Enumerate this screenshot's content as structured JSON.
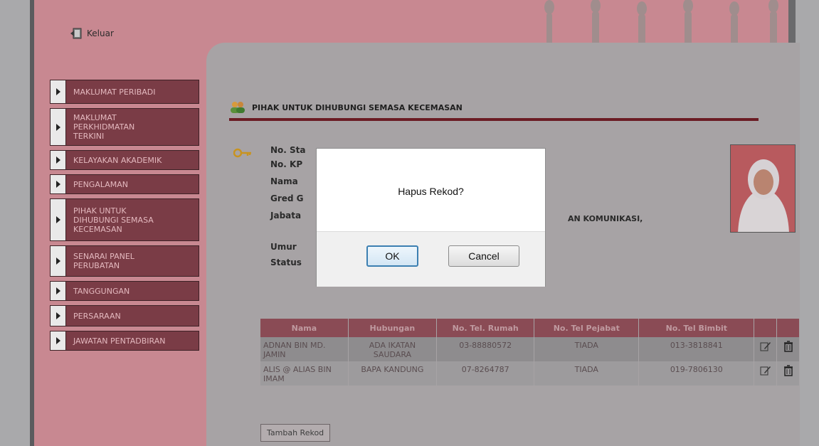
{
  "header": {
    "logout_label": "Keluar"
  },
  "sidebar": {
    "items": [
      {
        "label": "MAKLUMAT PERIBADI"
      },
      {
        "label": "MAKLUMAT PERKHIDMATAN TERKINI"
      },
      {
        "label": "KELAYAKAN AKADEMIK"
      },
      {
        "label": "PENGALAMAN"
      },
      {
        "label": "PIHAK UNTUK DIHUBUNGI SEMASA KECEMASAN"
      },
      {
        "label": "SENARAI PANEL PERUBATAN"
      },
      {
        "label": "TANGGUNGAN"
      },
      {
        "label": "PERSARAAN"
      },
      {
        "label": "JAWATAN PENTADBIRAN"
      }
    ]
  },
  "main": {
    "section_title": "PIHAK UNTUK DIHUBUNGI SEMASA KECEMASAN",
    "info": {
      "label_staf": "No. Sta",
      "label_kp": "No. KP",
      "label_nama": "Nama",
      "label_gred": "Gred G",
      "label_jabatan": "Jabata",
      "label_umur": "Umur",
      "label_status": "Status",
      "jabatan_value": "AN KOMUNIKASI,"
    },
    "table": {
      "headers": [
        "Nama",
        "Hubungan",
        "No. Tel. Rumah",
        "No. Tel Pejabat",
        "No. Tel Bimbit"
      ],
      "rows": [
        {
          "nama": "ADNAN BIN MD. JAMIN",
          "hubungan": "ADA IKATAN SAUDARA",
          "rumah": "03-88880572",
          "pejabat": "TIADA",
          "bimbit": "013-3818841"
        },
        {
          "nama": "ALIS @ ALIAS BIN IMAM",
          "hubungan": "BAPA KANDUNG",
          "rumah": "07-8264787",
          "pejabat": "TIADA",
          "bimbit": "019-7806130"
        }
      ]
    },
    "add_button": "Tambah Rekod"
  },
  "dialog": {
    "message": "Hapus Rekod?",
    "ok_label": "OK",
    "cancel_label": "Cancel"
  },
  "icons": {
    "logout": "door-exit-icon",
    "section": "people-icon",
    "key": "key-icon",
    "edit": "edit-icon",
    "delete": "trash-icon"
  },
  "colors": {
    "menu_bg": "#7a3c46",
    "accent_rule": "#6b1c24",
    "table_header": "#8a4b55",
    "ok_border": "#3c7fb1"
  }
}
